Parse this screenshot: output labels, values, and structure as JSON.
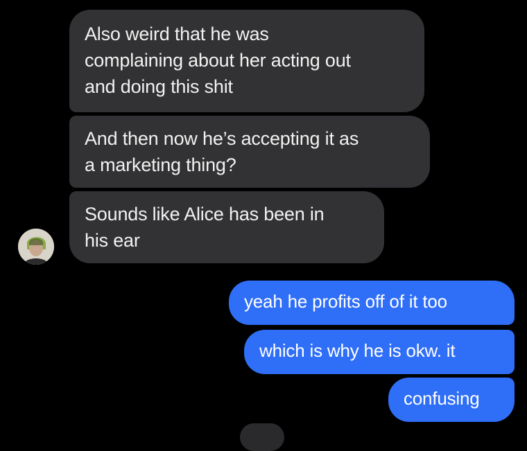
{
  "colors": {
    "background": "#000000",
    "incoming_bubble": "#323234",
    "outgoing_bubble": "#2f6ef7",
    "incoming_text": "#f2f2f2",
    "outgoing_text": "#ffffff"
  },
  "contact": {
    "avatar_icon": "contact-avatar"
  },
  "messages": {
    "incoming": [
      {
        "text": "Also weird that he was\ncomplaining about her acting out\nand doing this shit"
      },
      {
        "text": "And then now he’s accepting it as\na marketing thing?"
      },
      {
        "text": "Sounds like Alice has been in\nhis ear"
      }
    ],
    "outgoing": [
      {
        "text": "yeah he profits off of it too"
      },
      {
        "text": "which is why he is okw. it"
      },
      {
        "text": "confusing"
      }
    ]
  }
}
